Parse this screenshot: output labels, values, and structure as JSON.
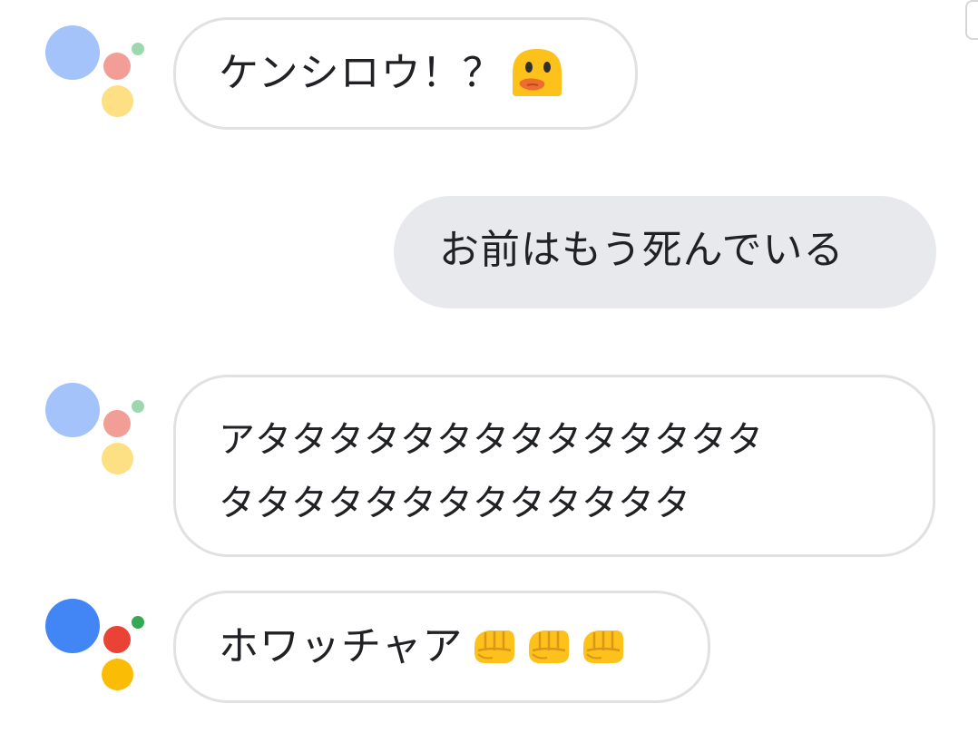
{
  "messages": [
    {
      "role": "assistant",
      "text": "ケンシロウ！？",
      "emoji": "hushed-face-icon"
    },
    {
      "role": "user",
      "text": "お前はもう死んでいる"
    },
    {
      "role": "assistant",
      "lines": [
        "アタタタタタタタタタタタタタタ",
        "タタタタタタタタタタタタタ"
      ]
    },
    {
      "role": "assistant",
      "text": "ホワッチャア",
      "emojis": [
        "oncoming-fist-icon",
        "oncoming-fist-icon",
        "oncoming-fist-icon"
      ]
    }
  ],
  "colors": {
    "assistant_blue": "#4285f4",
    "assistant_red": "#ea4335",
    "assistant_yellow": "#fbbc05",
    "assistant_green": "#34a853",
    "user_bubble": "#e8e9ed",
    "assistant_bubble_border": "#e1e1e1"
  }
}
